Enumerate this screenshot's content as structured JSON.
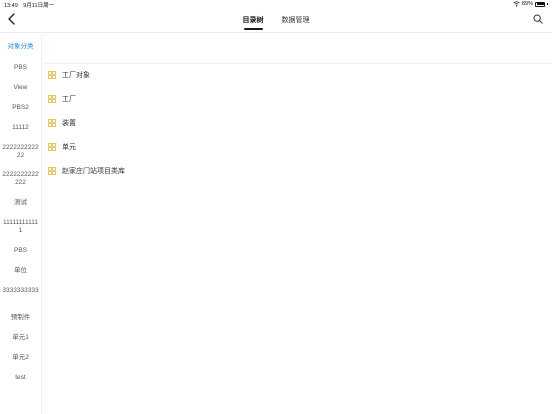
{
  "status_bar": {
    "time": "13:49",
    "date": "9月11日周一",
    "battery": "89%",
    "battery_level": 0.89
  },
  "nav": {
    "tabs": [
      {
        "label": "目录树",
        "active": true
      },
      {
        "label": "数据管理",
        "active": false
      }
    ],
    "back_icon": "chevron-left-icon",
    "search_icon": "search-icon"
  },
  "sidebar": {
    "items": [
      {
        "label": "对象分类",
        "active": true
      },
      {
        "label": "PBS"
      },
      {
        "label": "View"
      },
      {
        "label": "PBS2"
      },
      {
        "label": "11112"
      },
      {
        "label": "222222222222"
      },
      {
        "label": "2222222222222"
      },
      {
        "label": "测试"
      },
      {
        "label": "111111111111"
      },
      {
        "label": "PBS"
      },
      {
        "label": "单位"
      },
      {
        "label": "3333333333"
      },
      {
        "label": "预制件"
      },
      {
        "label": "单元1"
      },
      {
        "label": "单元2"
      },
      {
        "label": "test"
      }
    ]
  },
  "tree": {
    "icon": "grid-icon",
    "icon_color": "#e8b93a",
    "items": [
      {
        "label": "工厂对象"
      },
      {
        "label": "工厂"
      },
      {
        "label": "装置"
      },
      {
        "label": "单元"
      },
      {
        "label": "赵家庄门站项目类库"
      }
    ]
  },
  "colors": {
    "accent": "#1e88e5",
    "tree_icon": "#e8b93a"
  }
}
